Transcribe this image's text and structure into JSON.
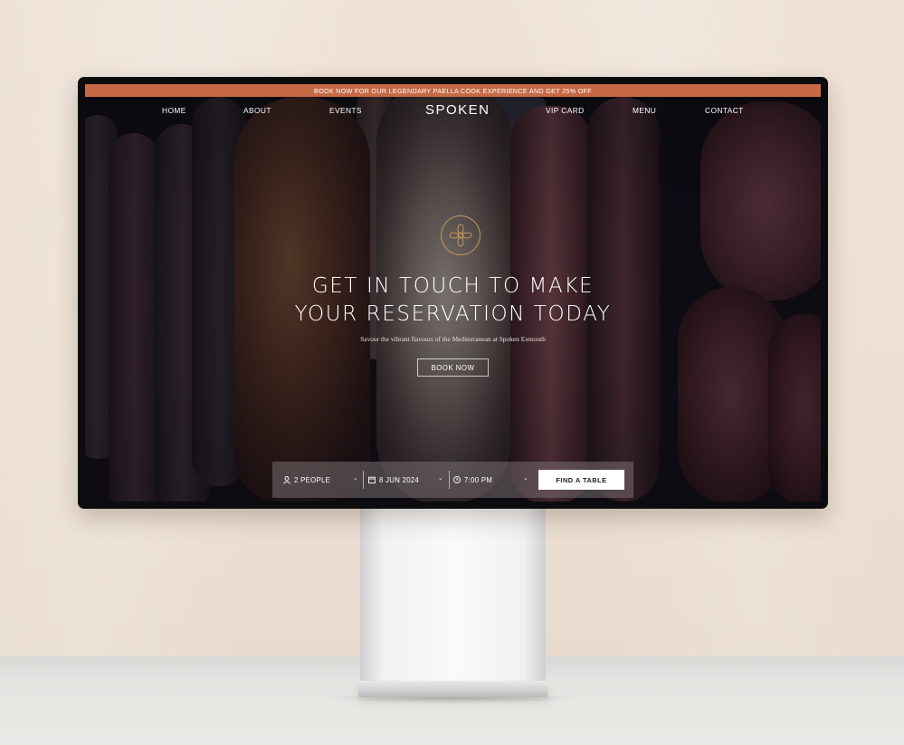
{
  "promo_banner": "BOOK NOW FOR OUR LEGENDARY PAELLA COOK EXPERIENCE AND GET 25% OFF",
  "nav": {
    "left": [
      "HOME",
      "ABOUT",
      "EVENTS"
    ],
    "logo": "SPOKEN",
    "right": [
      "VIP CARD",
      "MENU",
      "CONTACT"
    ]
  },
  "hero": {
    "headline_line1": "GET IN TOUCH TO MAKE",
    "headline_line2": "YOUR RESERVATION TODAY",
    "subline": "Savour the vibrant flavours of the Mediterranean at Spoken Exmouth",
    "cta": "BOOK NOW"
  },
  "booking": {
    "people": "2 PEOPLE",
    "date": "8 JUN 2024",
    "time": "7:00 PM",
    "submit": "FIND A TABLE"
  },
  "icons": {
    "people": "person-icon",
    "date": "calendar-icon",
    "time": "clock-icon",
    "dropdown": "chevron-down-icon",
    "emblem": "flower-emblem-icon"
  },
  "colors": {
    "promo_bg": "#c66a46",
    "emblem_gold": "#c59a55",
    "button_bg": "#ffffff"
  }
}
